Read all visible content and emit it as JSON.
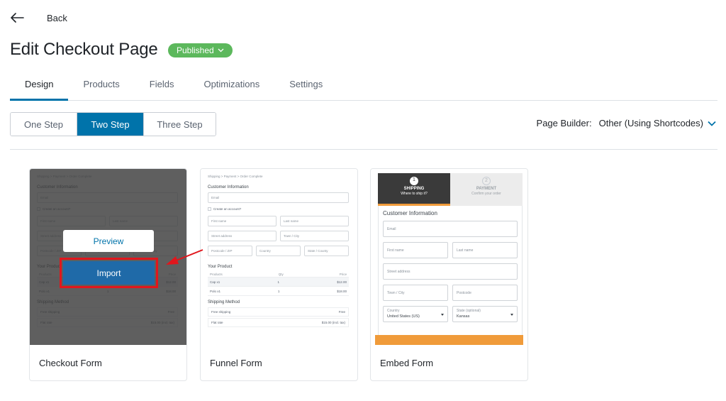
{
  "header": {
    "back_label": "Back",
    "title": "Edit Checkout Page",
    "status": "Published"
  },
  "tabs": [
    {
      "label": "Design",
      "active": true
    },
    {
      "label": "Products",
      "active": false
    },
    {
      "label": "Fields",
      "active": false
    },
    {
      "label": "Optimizations",
      "active": false
    },
    {
      "label": "Settings",
      "active": false
    }
  ],
  "steps": [
    {
      "label": "One Step",
      "active": false
    },
    {
      "label": "Two Step",
      "active": true
    },
    {
      "label": "Three Step",
      "active": false
    }
  ],
  "page_builder": {
    "label": "Page Builder:",
    "value": "Other (Using Shortcodes)"
  },
  "cards": [
    {
      "label": "Checkout Form",
      "preview_label": "Preview",
      "import_label": "Import"
    },
    {
      "label": "Funnel Form"
    },
    {
      "label": "Embed Form"
    }
  ],
  "funnel_thumb": {
    "breadcrumb": "Shipping  >  Payment  >  Order Complete",
    "customer_info": "Customer Information",
    "email": "Email",
    "create_account": "Create an account?",
    "first_name": "First name",
    "last_name": "Last name",
    "street": "Street address",
    "town": "Town / City",
    "postcode": "Postcode / ZIP",
    "country": "Country",
    "state": "State / County",
    "your_product": "Your Product",
    "col_products": "Products",
    "col_qty": "Qty",
    "col_price": "Price",
    "product1": "Cap x1",
    "product1_qty": "1",
    "product1_price": "$12.00",
    "product2": "Polo x1",
    "product2_qty": "1",
    "product2_price": "$18.00",
    "shipping_method": "Shipping Method",
    "ship1": "Free shipping",
    "ship1_price": "Free",
    "ship2": "Flat rate",
    "ship2_price": "$15.00 (incl. tax)"
  },
  "embed_thumb": {
    "step1_num": "1",
    "step1_title": "SHIPPING",
    "step1_sub": "Where to ship it?",
    "step2_num": "2",
    "step2_title": "PAYMENT",
    "step2_sub": "Confirm your order",
    "customer_info": "Customer Information",
    "email": "Email",
    "first_name": "First name",
    "last_name": "Last name",
    "street": "Street address",
    "town": "Town / City",
    "postcode": "Postcode",
    "country_label": "Country",
    "country_value": "United States (US)",
    "state_label": "State (optional)",
    "state_value": "Kansas"
  },
  "colors": {
    "accent": "#0073aa",
    "published": "#5cb85c",
    "highlight": "#e1161c",
    "embed_orange": "#f09b3a"
  }
}
